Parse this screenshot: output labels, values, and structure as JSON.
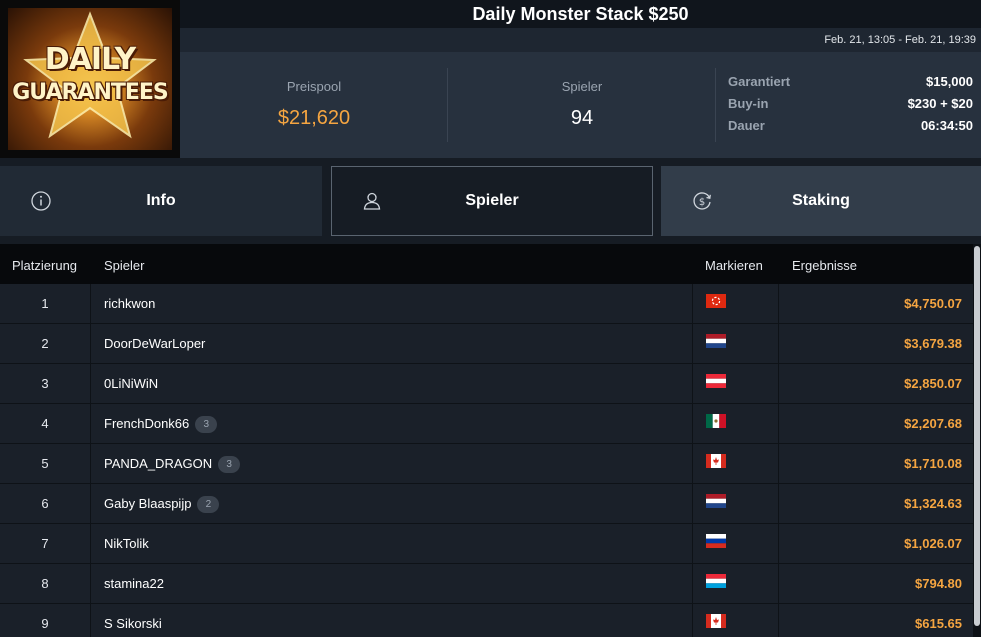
{
  "header": {
    "title": "Daily Monster Stack $250",
    "date_range": "Feb. 21, 13:05 - Feb. 21, 19:39",
    "logo_line1": "DAILY",
    "logo_line2": "GUARANTEES"
  },
  "stats": {
    "prize_label": "Preispool",
    "prize_value": "$21,620",
    "players_label": "Spieler",
    "players_value": "94",
    "guaranteed_label": "Garantiert",
    "guaranteed_value": "$15,000",
    "buyin_label": "Buy-in",
    "buyin_value": "$230 + $20",
    "duration_label": "Dauer",
    "duration_value": "06:34:50"
  },
  "tabs": {
    "info": "Info",
    "players": "Spieler",
    "staking": "Staking"
  },
  "table": {
    "headers": {
      "rank": "Platzierung",
      "player": "Spieler",
      "flag": "Markieren",
      "result": "Ergebnisse"
    },
    "rows": [
      {
        "rank": "1",
        "name": "richkwon",
        "badge": "",
        "flag": "hk",
        "result": "$4,750.07"
      },
      {
        "rank": "2",
        "name": "DoorDeWarLoper",
        "badge": "",
        "flag": "nl",
        "result": "$3,679.38"
      },
      {
        "rank": "3",
        "name": "0LiNiWiN",
        "badge": "",
        "flag": "at",
        "result": "$2,850.07"
      },
      {
        "rank": "4",
        "name": "FrenchDonk66",
        "badge": "3",
        "flag": "mx",
        "result": "$2,207.68"
      },
      {
        "rank": "5",
        "name": "PANDA_DRAGON",
        "badge": "3",
        "flag": "ca",
        "result": "$1,710.08"
      },
      {
        "rank": "6",
        "name": "Gaby Blaaspijp",
        "badge": "2",
        "flag": "nl",
        "result": "$1,324.63"
      },
      {
        "rank": "7",
        "name": "NikTolik",
        "badge": "",
        "flag": "ru",
        "result": "$1,026.07"
      },
      {
        "rank": "8",
        "name": "stamina22",
        "badge": "",
        "flag": "lu",
        "result": "$794.80"
      },
      {
        "rank": "9",
        "name": "S Sikorski",
        "badge": "",
        "flag": "ca",
        "result": "$615.65"
      }
    ]
  },
  "colors": {
    "accent": "#f5a541"
  }
}
